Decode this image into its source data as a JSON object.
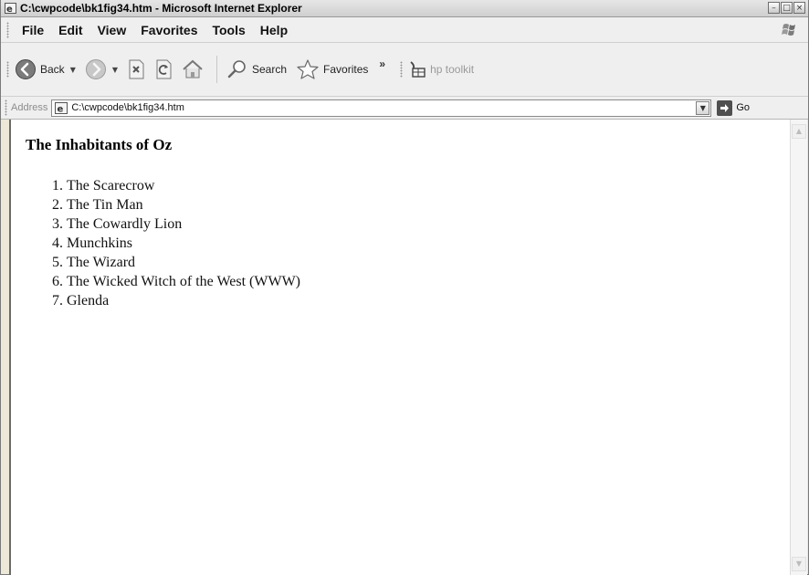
{
  "window": {
    "title": "C:\\cwpcode\\bk1fig34.htm - Microsoft Internet Explorer",
    "controls": {
      "minimize": "–",
      "maximize": "□",
      "close": "×"
    }
  },
  "menu": {
    "items": [
      "File",
      "Edit",
      "View",
      "Favorites",
      "Tools",
      "Help"
    ]
  },
  "toolbar": {
    "back_label": "Back",
    "search_label": "Search",
    "favorites_label": "Favorites",
    "overflow": "»",
    "hp_label": "hp toolkit"
  },
  "address": {
    "label": "Address",
    "url": "C:\\cwpcode\\bk1fig34.htm",
    "go_label": "Go"
  },
  "page": {
    "heading": "The Inhabitants of Oz",
    "items": [
      "The Scarecrow",
      "The Tin Man",
      "The Cowardly Lion",
      "Munchkins",
      "The Wizard",
      "The Wicked Witch of the West (WWW)",
      "Glenda"
    ]
  },
  "colors": {
    "chrome": "#efefef",
    "content_bg": "#ffffff",
    "text": "#111111"
  }
}
